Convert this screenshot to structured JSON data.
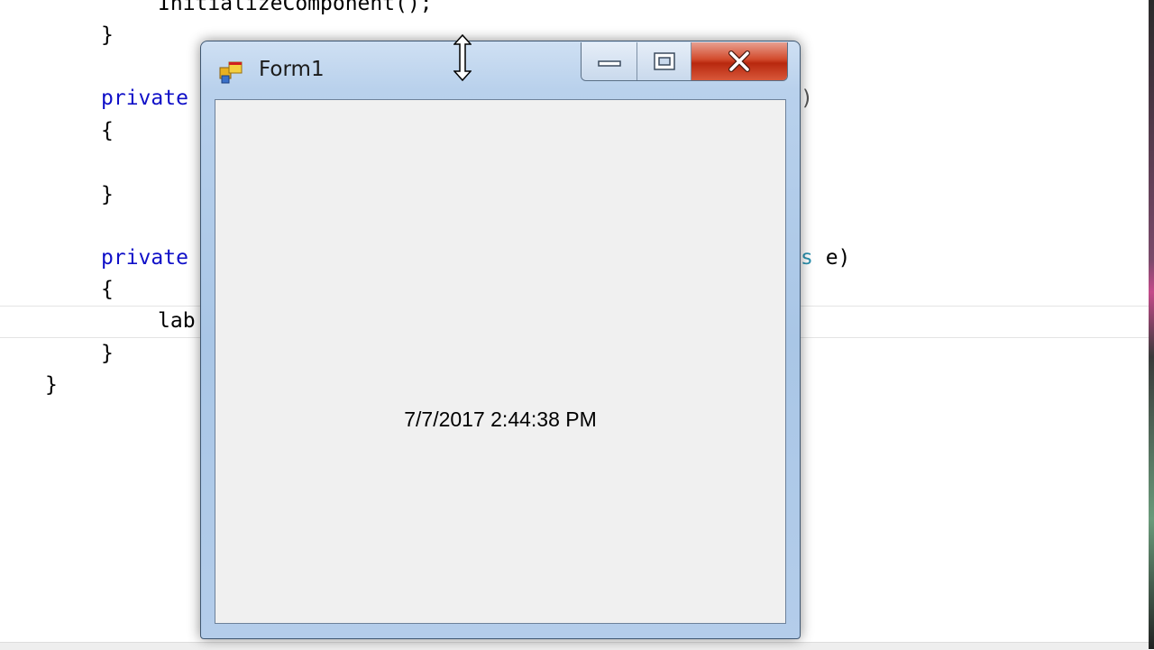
{
  "editor": {
    "lines": [
      "InitializeComponent();",
      "}",
      "private",
      "{",
      "}",
      "private",
      "{",
      "lab",
      "}",
      "}"
    ],
    "visible_tail_1": ")",
    "visible_tail_2_type": "s",
    "visible_tail_2_rest": " e)"
  },
  "window": {
    "title": "Form1",
    "icon": "form-app-icon",
    "buttons": {
      "minimize": "minimize-icon",
      "maximize": "maximize-icon",
      "close": "close-icon"
    },
    "label_text": "7/7/2017 2:44:38 PM"
  },
  "colors": {
    "keyword": "#1010c8",
    "type": "#2b91af",
    "close_button": "#d24a2c"
  }
}
